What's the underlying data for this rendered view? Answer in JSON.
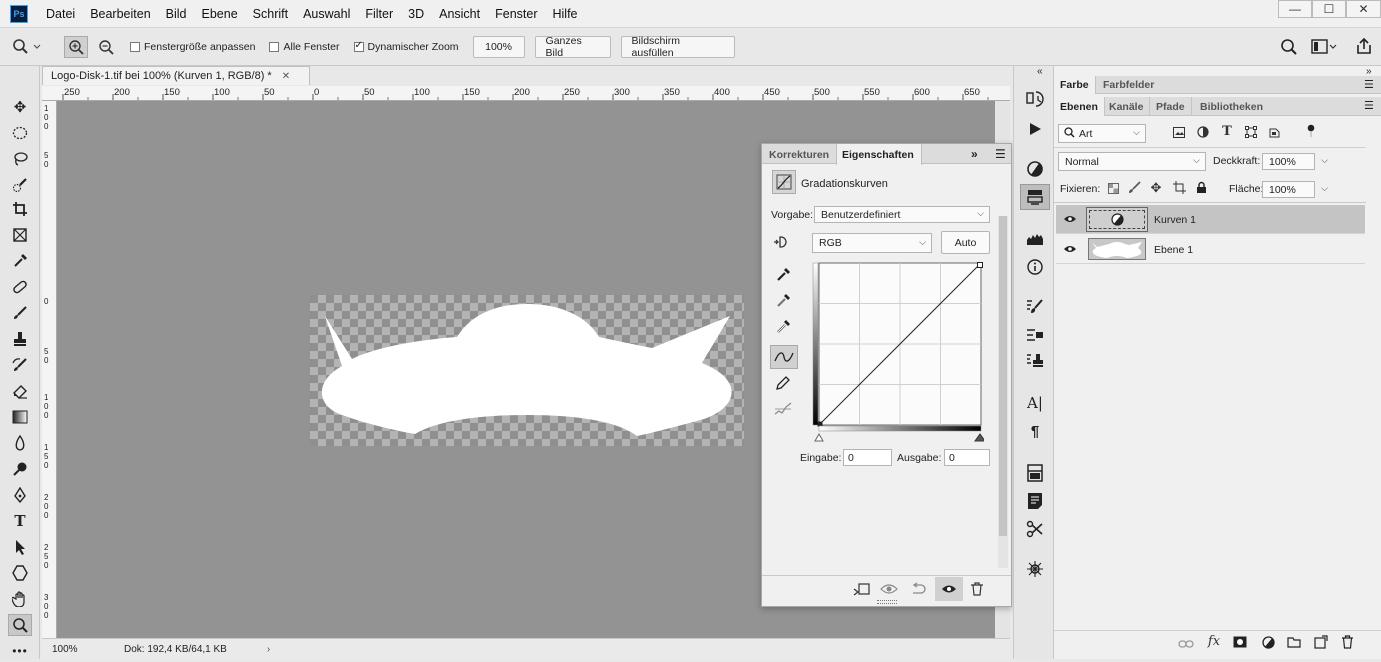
{
  "app": {
    "logo": "Ps"
  },
  "menu": [
    "Datei",
    "Bearbeiten",
    "Bild",
    "Ebene",
    "Schrift",
    "Auswahl",
    "Filter",
    "3D",
    "Ansicht",
    "Fenster",
    "Hilfe"
  ],
  "window_controls": {
    "minimize": "—",
    "maximize": "☐",
    "close": "✕"
  },
  "options": {
    "fit_window": "Fenstergröße anpassen",
    "fit_window_checked": false,
    "all_windows": "Alle Fenster",
    "all_windows_checked": false,
    "dynamic_zoom": "Dynamischer Zoom",
    "dynamic_zoom_checked": true,
    "zoom_value": "100%",
    "whole_image": "Ganzes Bild",
    "fill_screen": "Bildschirm ausfüllen"
  },
  "document": {
    "tab_title": "Logo-Disk-1.tif bei 100% (Kurven 1, RGB/8) *",
    "ruler_top": [
      "250",
      "200",
      "150",
      "100",
      "50",
      "0",
      "50",
      "100",
      "150",
      "200",
      "250",
      "300",
      "350",
      "400",
      "450",
      "500",
      "550",
      "600",
      "650"
    ],
    "ruler_left": [
      "1 0 0",
      "5 0",
      "0",
      "5 0",
      "1 0 0",
      "1 5 0",
      "2 0 0",
      "2 5 0",
      "3 0 0"
    ],
    "status_zoom": "100%",
    "status_doc": "Dok: 192,4 KB/64,1 KB"
  },
  "properties": {
    "tab_corrections": "Korrekturen",
    "tab_properties": "Eigenschaften",
    "title": "Gradationskurven",
    "preset_label": "Vorgabe:",
    "preset_value": "Benutzerdefiniert",
    "channel": "RGB",
    "auto": "Auto",
    "input_label": "Eingabe:",
    "input_value": "0",
    "output_label": "Ausgabe:",
    "output_value": "0"
  },
  "right_panel": {
    "top_tabs": [
      "Farbe",
      "Farbfelder"
    ],
    "layer_tabs": [
      "Ebenen",
      "Kanäle",
      "Pfade",
      "Bibliotheken"
    ],
    "filter_kind": "Art",
    "blend_mode": "Normal",
    "opacity_label": "Deckkraft:",
    "opacity_value": "100%",
    "lock_label": "Fixieren:",
    "fill_label": "Fläche:",
    "fill_value": "100%",
    "layers": [
      {
        "name": "Kurven 1",
        "selected": true
      },
      {
        "name": "Ebene 1",
        "selected": false
      }
    ]
  },
  "colors": {
    "canvas_bg": "#939393",
    "accent": "#31a8ff"
  }
}
